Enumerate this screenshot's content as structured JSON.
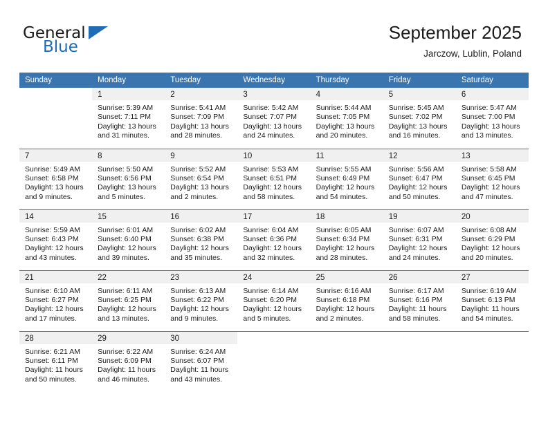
{
  "brand": {
    "name_top": "General",
    "name_bottom": "Blue",
    "accent_color": "#1f6cb4"
  },
  "header": {
    "title": "September 2025",
    "subtitle": "Jarczow, Lublin, Poland"
  },
  "theme": {
    "header_blue": "#3a75b0",
    "daynum_band": "#f0f0f0",
    "text": "#1b1b1b"
  },
  "weekday_headers": [
    "Sunday",
    "Monday",
    "Tuesday",
    "Wednesday",
    "Thursday",
    "Friday",
    "Saturday"
  ],
  "weeks": [
    [
      {
        "day": "",
        "lines": []
      },
      {
        "day": "1",
        "lines": [
          "Sunrise: 5:39 AM",
          "Sunset: 7:11 PM",
          "Daylight: 13 hours",
          "and 31 minutes."
        ]
      },
      {
        "day": "2",
        "lines": [
          "Sunrise: 5:41 AM",
          "Sunset: 7:09 PM",
          "Daylight: 13 hours",
          "and 28 minutes."
        ]
      },
      {
        "day": "3",
        "lines": [
          "Sunrise: 5:42 AM",
          "Sunset: 7:07 PM",
          "Daylight: 13 hours",
          "and 24 minutes."
        ]
      },
      {
        "day": "4",
        "lines": [
          "Sunrise: 5:44 AM",
          "Sunset: 7:05 PM",
          "Daylight: 13 hours",
          "and 20 minutes."
        ]
      },
      {
        "day": "5",
        "lines": [
          "Sunrise: 5:45 AM",
          "Sunset: 7:02 PM",
          "Daylight: 13 hours",
          "and 16 minutes."
        ]
      },
      {
        "day": "6",
        "lines": [
          "Sunrise: 5:47 AM",
          "Sunset: 7:00 PM",
          "Daylight: 13 hours",
          "and 13 minutes."
        ]
      }
    ],
    [
      {
        "day": "7",
        "lines": [
          "Sunrise: 5:49 AM",
          "Sunset: 6:58 PM",
          "Daylight: 13 hours",
          "and 9 minutes."
        ]
      },
      {
        "day": "8",
        "lines": [
          "Sunrise: 5:50 AM",
          "Sunset: 6:56 PM",
          "Daylight: 13 hours",
          "and 5 minutes."
        ]
      },
      {
        "day": "9",
        "lines": [
          "Sunrise: 5:52 AM",
          "Sunset: 6:54 PM",
          "Daylight: 13 hours",
          "and 2 minutes."
        ]
      },
      {
        "day": "10",
        "lines": [
          "Sunrise: 5:53 AM",
          "Sunset: 6:51 PM",
          "Daylight: 12 hours",
          "and 58 minutes."
        ]
      },
      {
        "day": "11",
        "lines": [
          "Sunrise: 5:55 AM",
          "Sunset: 6:49 PM",
          "Daylight: 12 hours",
          "and 54 minutes."
        ]
      },
      {
        "day": "12",
        "lines": [
          "Sunrise: 5:56 AM",
          "Sunset: 6:47 PM",
          "Daylight: 12 hours",
          "and 50 minutes."
        ]
      },
      {
        "day": "13",
        "lines": [
          "Sunrise: 5:58 AM",
          "Sunset: 6:45 PM",
          "Daylight: 12 hours",
          "and 47 minutes."
        ]
      }
    ],
    [
      {
        "day": "14",
        "lines": [
          "Sunrise: 5:59 AM",
          "Sunset: 6:43 PM",
          "Daylight: 12 hours",
          "and 43 minutes."
        ]
      },
      {
        "day": "15",
        "lines": [
          "Sunrise: 6:01 AM",
          "Sunset: 6:40 PM",
          "Daylight: 12 hours",
          "and 39 minutes."
        ]
      },
      {
        "day": "16",
        "lines": [
          "Sunrise: 6:02 AM",
          "Sunset: 6:38 PM",
          "Daylight: 12 hours",
          "and 35 minutes."
        ]
      },
      {
        "day": "17",
        "lines": [
          "Sunrise: 6:04 AM",
          "Sunset: 6:36 PM",
          "Daylight: 12 hours",
          "and 32 minutes."
        ]
      },
      {
        "day": "18",
        "lines": [
          "Sunrise: 6:05 AM",
          "Sunset: 6:34 PM",
          "Daylight: 12 hours",
          "and 28 minutes."
        ]
      },
      {
        "day": "19",
        "lines": [
          "Sunrise: 6:07 AM",
          "Sunset: 6:31 PM",
          "Daylight: 12 hours",
          "and 24 minutes."
        ]
      },
      {
        "day": "20",
        "lines": [
          "Sunrise: 6:08 AM",
          "Sunset: 6:29 PM",
          "Daylight: 12 hours",
          "and 20 minutes."
        ]
      }
    ],
    [
      {
        "day": "21",
        "lines": [
          "Sunrise: 6:10 AM",
          "Sunset: 6:27 PM",
          "Daylight: 12 hours",
          "and 17 minutes."
        ]
      },
      {
        "day": "22",
        "lines": [
          "Sunrise: 6:11 AM",
          "Sunset: 6:25 PM",
          "Daylight: 12 hours",
          "and 13 minutes."
        ]
      },
      {
        "day": "23",
        "lines": [
          "Sunrise: 6:13 AM",
          "Sunset: 6:22 PM",
          "Daylight: 12 hours",
          "and 9 minutes."
        ]
      },
      {
        "day": "24",
        "lines": [
          "Sunrise: 6:14 AM",
          "Sunset: 6:20 PM",
          "Daylight: 12 hours",
          "and 5 minutes."
        ]
      },
      {
        "day": "25",
        "lines": [
          "Sunrise: 6:16 AM",
          "Sunset: 6:18 PM",
          "Daylight: 12 hours",
          "and 2 minutes."
        ]
      },
      {
        "day": "26",
        "lines": [
          "Sunrise: 6:17 AM",
          "Sunset: 6:16 PM",
          "Daylight: 11 hours",
          "and 58 minutes."
        ]
      },
      {
        "day": "27",
        "lines": [
          "Sunrise: 6:19 AM",
          "Sunset: 6:13 PM",
          "Daylight: 11 hours",
          "and 54 minutes."
        ]
      }
    ],
    [
      {
        "day": "28",
        "lines": [
          "Sunrise: 6:21 AM",
          "Sunset: 6:11 PM",
          "Daylight: 11 hours",
          "and 50 minutes."
        ]
      },
      {
        "day": "29",
        "lines": [
          "Sunrise: 6:22 AM",
          "Sunset: 6:09 PM",
          "Daylight: 11 hours",
          "and 46 minutes."
        ]
      },
      {
        "day": "30",
        "lines": [
          "Sunrise: 6:24 AM",
          "Sunset: 6:07 PM",
          "Daylight: 11 hours",
          "and 43 minutes."
        ]
      },
      {
        "day": "",
        "lines": []
      },
      {
        "day": "",
        "lines": []
      },
      {
        "day": "",
        "lines": []
      },
      {
        "day": "",
        "lines": []
      }
    ]
  ]
}
